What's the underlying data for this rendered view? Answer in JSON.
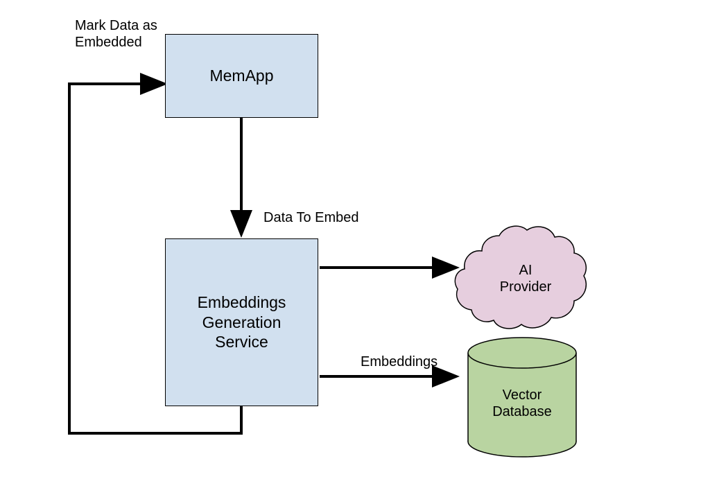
{
  "boxes": {
    "memapp": "MemApp",
    "service": "Embeddings\nGeneration\nService"
  },
  "labels": {
    "mark_data": "Mark Data as\nEmbedded",
    "data_to_embed": "Data To Embed",
    "embeddings": "Embeddings"
  },
  "cloud": "AI\nProvider",
  "database": "Vector\nDatabase"
}
